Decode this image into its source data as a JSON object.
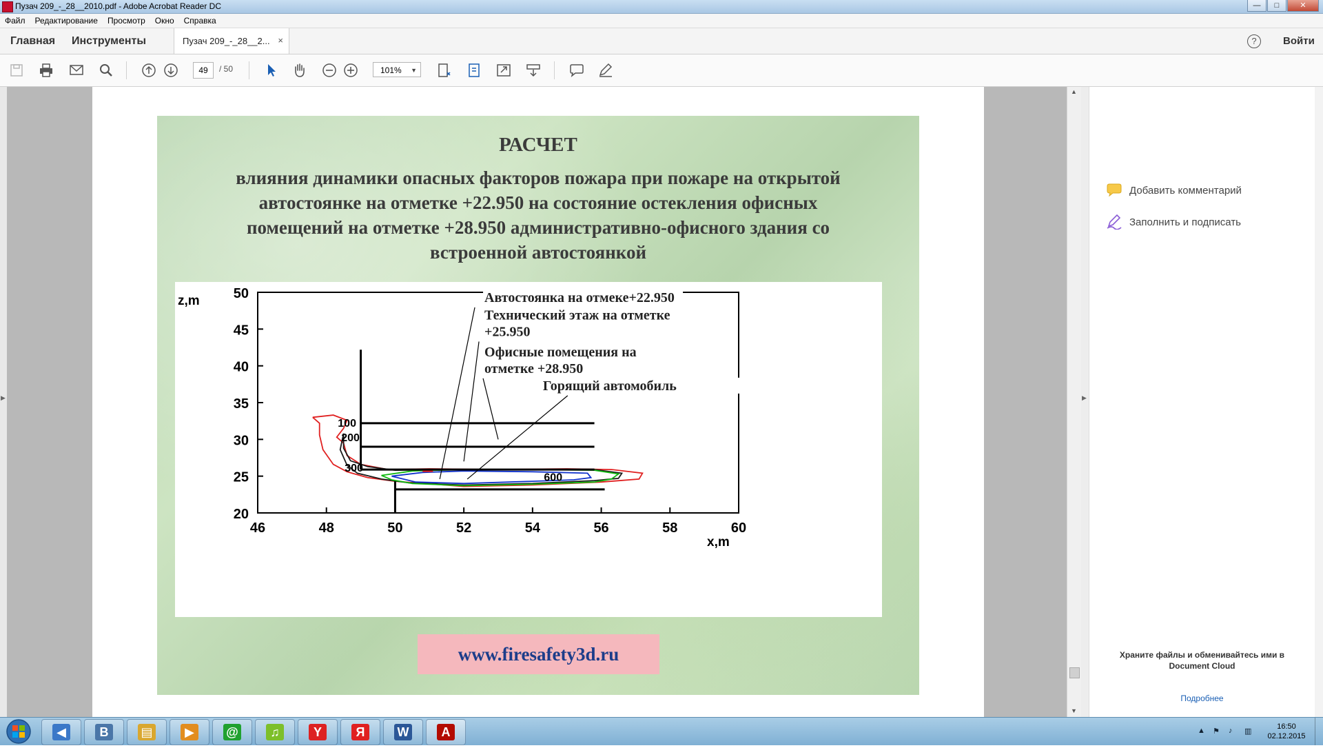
{
  "window": {
    "title": "Пузач 209_-_28__2010.pdf - Adobe Acrobat Reader DC",
    "minimize": "—",
    "maximize": "□",
    "close": "✕"
  },
  "menu": [
    "Файл",
    "Редактирование",
    "Просмотр",
    "Окно",
    "Справка"
  ],
  "nav": {
    "home": "Главная",
    "tools": "Инструменты",
    "signin": "Войти",
    "help": "?"
  },
  "doc_tab": {
    "label": "Пузач 209_-_28__2...",
    "close": "×"
  },
  "toolbar": {
    "page_current": "49",
    "page_total": "/ 50",
    "zoom": "101%"
  },
  "slide": {
    "title": "РАСЧЕТ",
    "subtitle_lines": [
      "влияния динамики опасных факторов пожара при пожаре на открытой",
      "автостоянке на отметке +22.950 на состояние остекления офисных",
      "помещений на отметке +28.950 административно-офисного здания со",
      "встроенной автостоянкой"
    ],
    "url": "www.firesafety3d.ru"
  },
  "chart_data": {
    "type": "line",
    "xlabel": "x,m",
    "ylabel": "z,m",
    "xlim": [
      46,
      60
    ],
    "ylim": [
      20,
      50
    ],
    "xticks": [
      46,
      48,
      50,
      52,
      54,
      56,
      58,
      60
    ],
    "yticks": [
      20,
      25,
      30,
      35,
      40,
      45,
      50
    ],
    "contour_labels": [
      {
        "text": "100",
        "x": 48.6,
        "z": 32.3
      },
      {
        "text": "200",
        "x": 48.7,
        "z": 30.3
      },
      {
        "text": "300",
        "x": 48.8,
        "z": 26.2
      },
      {
        "text": "600",
        "x": 54.6,
        "z": 24.9
      }
    ],
    "annotations": [
      {
        "lines": [
          "Автостоянка на отмеке+22.950"
        ],
        "x": 52.6,
        "z": 48.7,
        "arrow_to": [
          51.3,
          24.6
        ]
      },
      {
        "lines": [
          "Технический этаж на отметке",
          "+25.950"
        ],
        "x": 52.6,
        "z": 46.3,
        "arrow_to": [
          52.0,
          27.0
        ]
      },
      {
        "lines": [
          "Офисные помещения на",
          "отметке +28.950"
        ],
        "x": 52.6,
        "z": 41.3,
        "arrow_to": [
          53.0,
          30.0
        ]
      },
      {
        "lines": [
          "Горящий автомобиль"
        ],
        "x": 54.3,
        "z": 36.7,
        "arrow_to": [
          52.1,
          24.6
        ]
      }
    ],
    "structure_lines": [
      {
        "name": "vertical-wall",
        "points": [
          [
            49.0,
            42.2
          ],
          [
            49.0,
            25.9
          ]
        ]
      },
      {
        "name": "vertical-post",
        "points": [
          [
            50.0,
            24.3
          ],
          [
            50.0,
            20.0
          ]
        ]
      },
      {
        "name": "floor-32",
        "points": [
          [
            49.0,
            32.2
          ],
          [
            55.8,
            32.2
          ]
        ]
      },
      {
        "name": "floor-29",
        "points": [
          [
            49.0,
            29.0
          ],
          [
            55.8,
            29.0
          ]
        ]
      },
      {
        "name": "floor-26",
        "points": [
          [
            49.0,
            25.9
          ],
          [
            55.8,
            25.9
          ]
        ]
      },
      {
        "name": "floor-23",
        "points": [
          [
            50.0,
            23.2
          ],
          [
            56.1,
            23.2
          ]
        ]
      }
    ],
    "series": [
      {
        "color": "#e02020",
        "points": [
          [
            47.6,
            33.0
          ],
          [
            48.2,
            33.3
          ],
          [
            48.6,
            32.6
          ],
          [
            48.5,
            31.5
          ],
          [
            48.3,
            30.3
          ],
          [
            48.5,
            29.5
          ],
          [
            48.6,
            27.8
          ],
          [
            49.0,
            26.6
          ],
          [
            49.8,
            25.9
          ],
          [
            51.0,
            26.0
          ],
          [
            53.0,
            25.9
          ],
          [
            55.0,
            26.0
          ],
          [
            56.3,
            25.9
          ],
          [
            57.2,
            25.4
          ],
          [
            57.1,
            24.6
          ],
          [
            56.0,
            24.2
          ],
          [
            54.0,
            23.8
          ],
          [
            52.0,
            23.6
          ],
          [
            50.0,
            24.3
          ],
          [
            49.2,
            24.8
          ],
          [
            48.6,
            25.6
          ],
          [
            48.2,
            26.6
          ],
          [
            47.9,
            28.6
          ],
          [
            47.8,
            30.6
          ],
          [
            47.8,
            32.2
          ],
          [
            47.6,
            33.0
          ]
        ]
      },
      {
        "color": "#1a1a1a",
        "points": [
          [
            48.5,
            30.8
          ],
          [
            48.5,
            28.8
          ],
          [
            48.7,
            27.1
          ],
          [
            49.2,
            26.3
          ],
          [
            50.0,
            25.8
          ],
          [
            52.0,
            25.9
          ],
          [
            54.0,
            25.9
          ],
          [
            55.8,
            25.9
          ],
          [
            56.6,
            25.4
          ],
          [
            56.5,
            24.7
          ],
          [
            55.8,
            24.4
          ],
          [
            54.0,
            24.0
          ],
          [
            52.0,
            23.8
          ],
          [
            50.4,
            24.1
          ],
          [
            49.6,
            24.6
          ],
          [
            48.9,
            25.4
          ],
          [
            48.6,
            26.5
          ],
          [
            48.4,
            28.6
          ],
          [
            48.5,
            30.8
          ]
        ]
      },
      {
        "color": "#11b811",
        "points": [
          [
            49.6,
            25.1
          ],
          [
            50.5,
            25.7
          ],
          [
            52.0,
            25.9
          ],
          [
            54.0,
            25.9
          ],
          [
            55.8,
            25.8
          ],
          [
            56.5,
            25.3
          ],
          [
            56.3,
            24.6
          ],
          [
            55.8,
            24.2
          ],
          [
            54.0,
            23.9
          ],
          [
            52.0,
            23.7
          ],
          [
            50.5,
            24.0
          ],
          [
            49.9,
            24.5
          ],
          [
            49.6,
            25.1
          ]
        ]
      },
      {
        "color": "#1133cc",
        "points": [
          [
            49.9,
            25.0
          ],
          [
            50.8,
            25.5
          ],
          [
            52.0,
            25.7
          ],
          [
            54.0,
            25.6
          ],
          [
            55.6,
            25.4
          ],
          [
            55.7,
            24.8
          ],
          [
            55.2,
            24.5
          ],
          [
            54.0,
            24.3
          ],
          [
            52.0,
            24.0
          ],
          [
            50.6,
            24.2
          ],
          [
            49.9,
            25.0
          ]
        ]
      },
      {
        "color": "#e02020",
        "points": [
          [
            50.8,
            25.7
          ],
          [
            51.1,
            25.7
          ]
        ]
      }
    ]
  },
  "right_panel": {
    "tools": [
      "Добавить комментарий",
      "Заполнить и подписать"
    ],
    "promo_line1": "Храните файлы и обменивайтесь ими в",
    "promo_line2": "Document Cloud",
    "more": "Подробнее"
  },
  "taskbar": {
    "apps": [
      {
        "name": "volume-app",
        "glyph": "◀",
        "color": "#3a78c8"
      },
      {
        "name": "vk-app",
        "glyph": "B",
        "color": "#4a76a8"
      },
      {
        "name": "file-explorer-app",
        "glyph": "▤",
        "color": "#d9a72f"
      },
      {
        "name": "media-player-app",
        "glyph": "▶",
        "color": "#e28d1f"
      },
      {
        "name": "mail-agent-app",
        "glyph": "@",
        "color": "#20a12f"
      },
      {
        "name": "music-app",
        "glyph": "♫",
        "color": "#7dbf2a"
      },
      {
        "name": "yandex-browser-app",
        "glyph": "Y",
        "color": "#dd2222"
      },
      {
        "name": "yandex-app",
        "glyph": "Я",
        "color": "#e02020"
      },
      {
        "name": "word-app",
        "glyph": "W",
        "color": "#2b5797"
      },
      {
        "name": "acrobat-app",
        "glyph": "A",
        "color": "#b30b00"
      }
    ],
    "time": "16:50",
    "date": "02.12.2015"
  }
}
